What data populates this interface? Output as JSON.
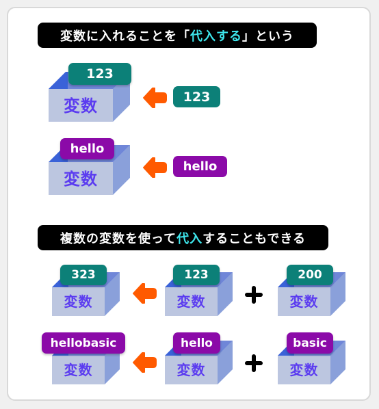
{
  "colors": {
    "teal_value": "#0c8078",
    "purple_value": "#8b0aa8",
    "arrow": "#ff5a00",
    "box_front": "#bcc6e0",
    "box_top": "#3a62d8",
    "box_side": "#8aa0da",
    "box_label": "#5b3cf0",
    "highlight": "#3ee6ec"
  },
  "section1": {
    "title_pre": "変数に入れることを「",
    "title_highlight": "代入する",
    "title_post": "」という",
    "examples": [
      {
        "box_label": "変数",
        "stored_value": "123",
        "value_type": "number",
        "input_value": "123",
        "arrow_icon": "left-arrow-icon"
      },
      {
        "box_label": "変数",
        "stored_value": "hello",
        "value_type": "string",
        "input_value": "hello",
        "arrow_icon": "left-arrow-icon"
      }
    ]
  },
  "section2": {
    "title_pre": "複数の変数を使って",
    "title_highlight": "代入",
    "title_post": "することもできる",
    "rows": [
      {
        "result": {
          "box_label": "変数",
          "value": "323",
          "value_type": "number"
        },
        "left": {
          "box_label": "変数",
          "value": "123",
          "value_type": "number"
        },
        "operator": "+",
        "right": {
          "box_label": "変数",
          "value": "200",
          "value_type": "number"
        }
      },
      {
        "result": {
          "box_label": "変数",
          "value": "hellobasic",
          "value_type": "string"
        },
        "left": {
          "box_label": "変数",
          "value": "hello",
          "value_type": "string"
        },
        "operator": "+",
        "right": {
          "box_label": "変数",
          "value": "basic",
          "value_type": "string"
        }
      }
    ]
  }
}
